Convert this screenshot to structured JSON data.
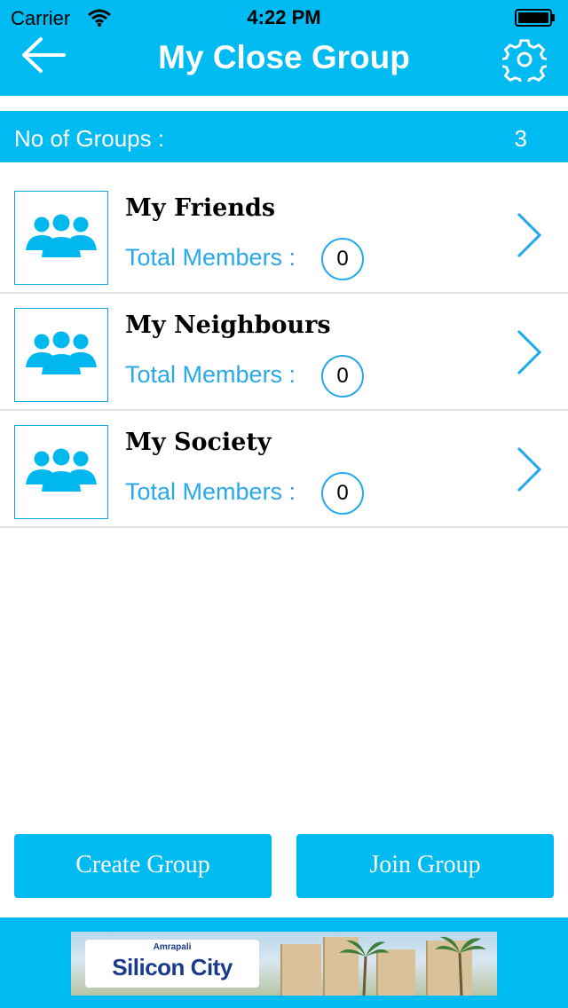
{
  "status_bar": {
    "carrier": "Carrier",
    "time": "4:22 PM"
  },
  "nav": {
    "title": "My Close Group",
    "back_icon": "back-arrow-icon",
    "settings_icon": "gear-icon"
  },
  "summary": {
    "label": "No of Groups :",
    "count": "3"
  },
  "groups": [
    {
      "name": "My Friends",
      "members_label": "Total Members :",
      "members_count": "0"
    },
    {
      "name": "My Neighbours",
      "members_label": "Total Members :",
      "members_count": "0"
    },
    {
      "name": "My Society",
      "members_label": "Total Members :",
      "members_count": "0"
    }
  ],
  "actions": {
    "create_label": "Create Group",
    "join_label": "Join Group"
  },
  "banner": {
    "brand": "Amrapali",
    "name": "Silicon City"
  },
  "colors": {
    "accent": "#00bbf2",
    "link_blue": "#29a9e9",
    "divider": "#e2e2e2"
  }
}
